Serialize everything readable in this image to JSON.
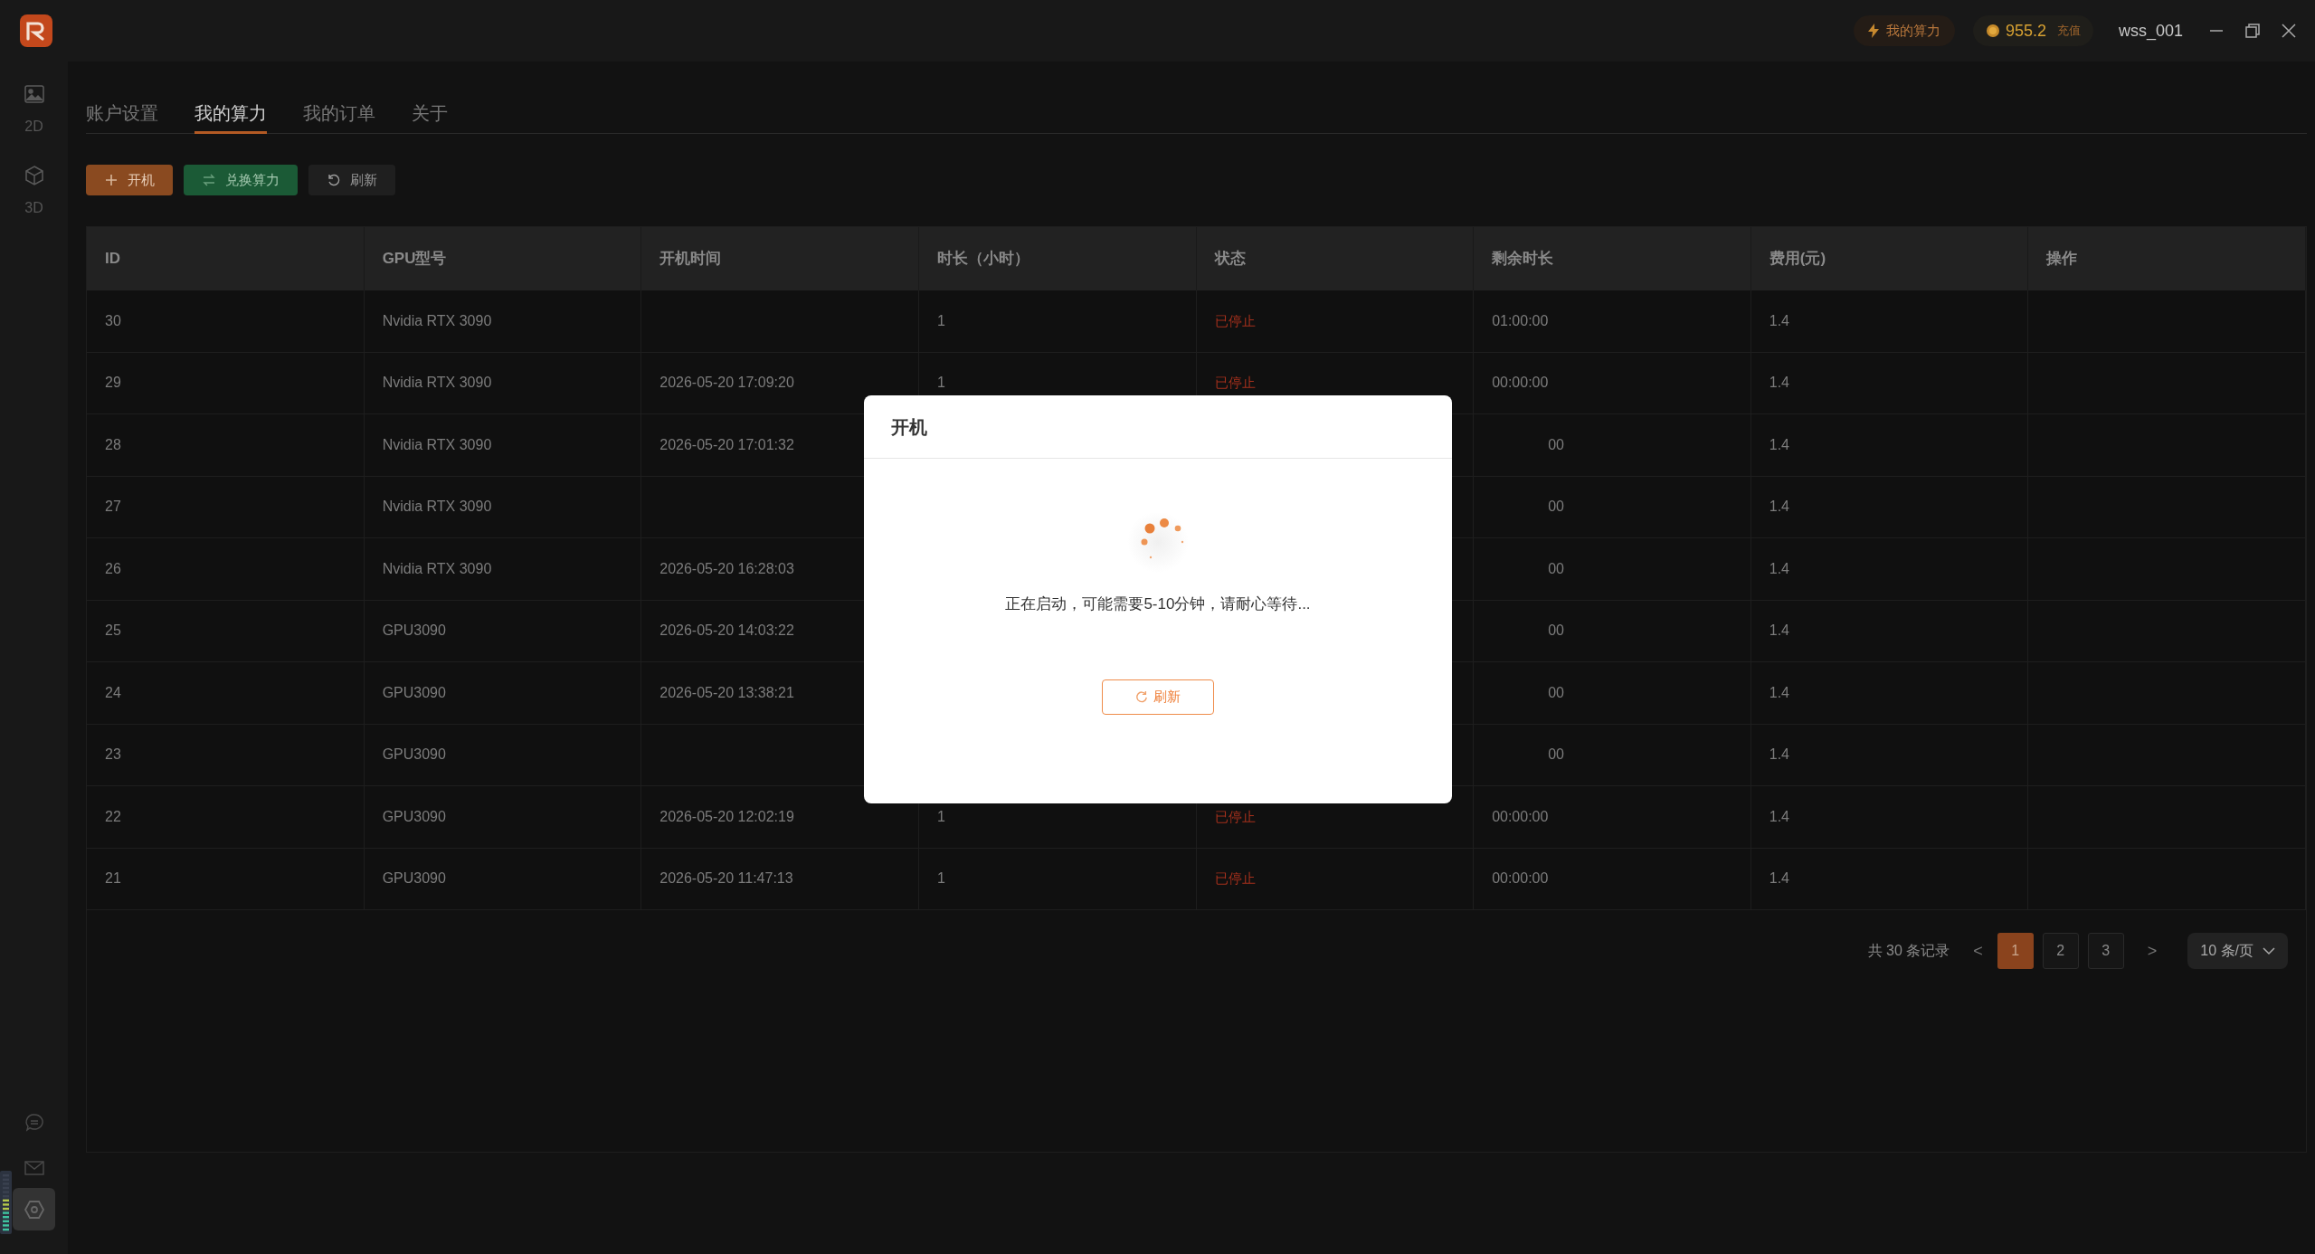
{
  "top_bar": {
    "power_button": "我的算力",
    "balance": "955.2",
    "recharge": "充值",
    "username": "wss_001"
  },
  "sidebar": {
    "items": [
      {
        "kind": "image",
        "label": "2D"
      },
      {
        "kind": "cube",
        "label": "3D"
      }
    ]
  },
  "tabs": [
    {
      "label": "账户设置",
      "selected": false
    },
    {
      "label": "我的算力",
      "selected": true
    },
    {
      "label": "我的订单",
      "selected": false
    },
    {
      "label": "关于",
      "selected": false
    }
  ],
  "toolbar": [
    {
      "kind": "add",
      "label": "开机"
    },
    {
      "kind": "exchange",
      "label": "兑换算力"
    },
    {
      "kind": "refresh",
      "label": "刷新"
    }
  ],
  "table": {
    "columns": [
      "ID",
      "GPU型号",
      "开机时间",
      "时长（小时）",
      "状态",
      "剩余时长",
      "费用(元)",
      "操作"
    ],
    "rows": [
      {
        "kind": "full",
        "id": "30",
        "gpu": "Nvidia RTX 3090",
        "duration": "1",
        "status": "已停止",
        "remaining": "01:00:00",
        "cost": "1.4"
      },
      {
        "kind": "full",
        "id": "29",
        "gpu": "Nvidia RTX 3090",
        "start": "2026-05-20 17:09:20",
        "duration": "1",
        "status": "已停止",
        "remaining": "00:00:00",
        "cost": "1.4"
      },
      {
        "kind": "covered",
        "id": "28",
        "gpu": "Nvidia RTX 3090",
        "start": "2026-05-20 17:01:32",
        "remaining": "00",
        "cost": "1.4"
      },
      {
        "kind": "covered",
        "id": "27",
        "gpu": "Nvidia RTX 3090",
        "remaining": "00",
        "cost": "1.4"
      },
      {
        "kind": "covered",
        "id": "26",
        "gpu": "Nvidia RTX 3090",
        "start": "2026-05-20 16:28:03",
        "remaining": "00",
        "cost": "1.4"
      },
      {
        "kind": "covered",
        "id": "25",
        "gpu": "GPU3090",
        "start": "2026-05-20 14:03:22",
        "remaining": "00",
        "cost": "1.4"
      },
      {
        "kind": "covered",
        "id": "24",
        "gpu": "GPU3090",
        "start": "2026-05-20 13:38:21",
        "remaining": "00",
        "cost": "1.4"
      },
      {
        "kind": "covered",
        "id": "23",
        "gpu": "GPU3090",
        "remaining": "00",
        "cost": "1.4"
      },
      {
        "kind": "full",
        "id": "22",
        "gpu": "GPU3090",
        "start": "2026-05-20 12:02:19",
        "duration": "1",
        "status": "已停止",
        "remaining": "00:00:00",
        "cost": "1.4"
      },
      {
        "kind": "full",
        "id": "21",
        "gpu": "GPU3090",
        "start": "2026-05-20 11:47:13",
        "duration": "1",
        "status": "已停止",
        "remaining": "00:00:00",
        "cost": "1.4"
      }
    ]
  },
  "pagination": {
    "total": "共 30 条记录",
    "prev": "<",
    "pages": [
      {
        "label": "1",
        "selected": true
      },
      {
        "label": "2",
        "selected": false
      },
      {
        "label": "3",
        "selected": false
      }
    ],
    "next": ">",
    "page_size": "10 条/页"
  },
  "dialog": {
    "title": "开机",
    "message": "正在启动，可能需要5-10分钟，请耐心等待...",
    "button": "刷新"
  }
}
